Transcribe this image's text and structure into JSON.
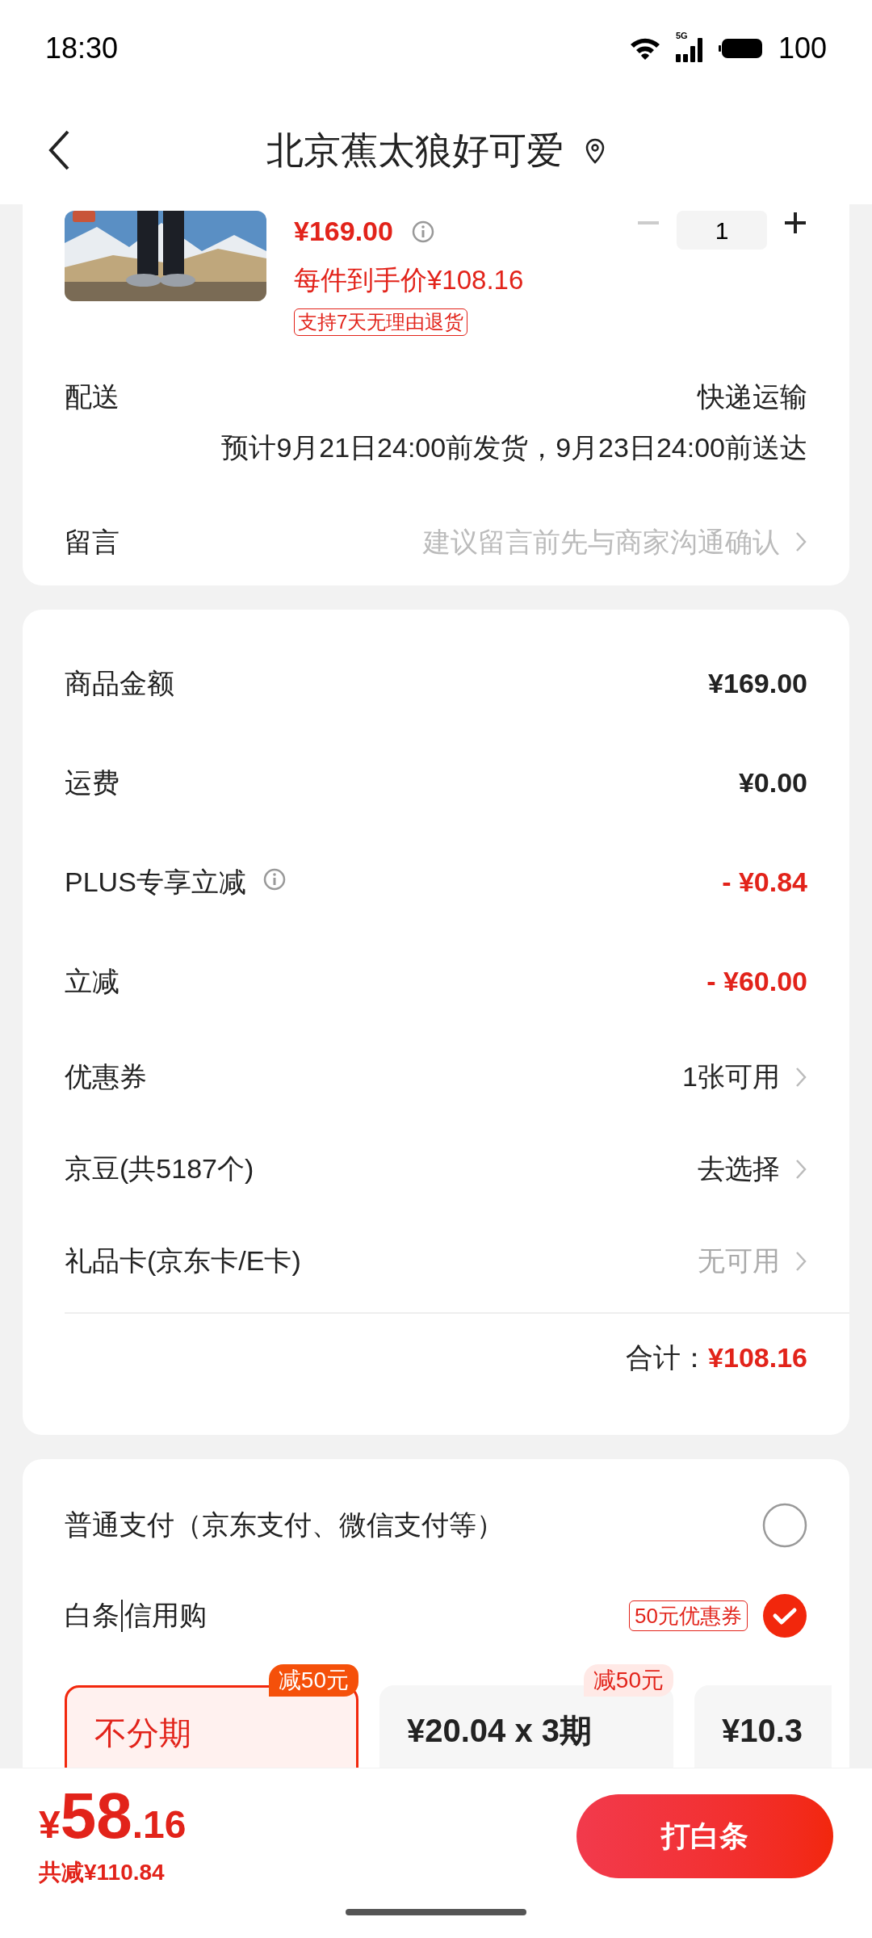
{
  "status_bar": {
    "time": "18:30",
    "network": "5G",
    "battery": "100"
  },
  "header": {
    "title": "北京蕉太狼好可爱"
  },
  "product": {
    "price": "¥169.00",
    "per_item_price": "每件到手价¥108.16",
    "tag": "支持7天无理由退货",
    "quantity": "1"
  },
  "delivery": {
    "label": "配送",
    "method": "快递运输",
    "estimate": "预计9月21日24:00前发货，9月23日24:00前送达"
  },
  "note": {
    "label": "留言",
    "placeholder": "建议留言前先与商家沟通确认"
  },
  "summary": {
    "rows": [
      {
        "kind": "amount",
        "label": "商品金额",
        "value": "¥169.00",
        "info": false
      },
      {
        "kind": "amount",
        "label": "运费",
        "value": "¥0.00",
        "info": false
      },
      {
        "kind": "discount",
        "label": "PLUS专享立减",
        "value": "- ¥0.84",
        "info": true
      },
      {
        "kind": "discount",
        "label": "立减",
        "value": "- ¥60.00",
        "info": false
      },
      {
        "kind": "option",
        "label": "优惠券",
        "value": "1张可用",
        "info": false,
        "disabled": false
      },
      {
        "kind": "option",
        "label": "京豆(共5187个)",
        "value": "去选择",
        "info": false,
        "disabled": false
      },
      {
        "kind": "option",
        "label": "礼品卡(京东卡/E卡)",
        "value": "无可用",
        "info": false,
        "disabled": true
      }
    ],
    "total_label": "合计：",
    "total": "¥108.16"
  },
  "payment": {
    "methods": [
      {
        "label_parts": [
          "普通支付（京东支付、微信支付等）"
        ],
        "selected": false
      },
      {
        "label_parts": [
          "白条",
          "信用购"
        ],
        "badge": "50元优惠券",
        "selected": true
      }
    ],
    "plans": [
      {
        "title": "不分期",
        "tag": "减50元",
        "selected": true
      },
      {
        "title": "¥20.04 x 3期",
        "tag": "减50元",
        "selected": false
      },
      {
        "title": "¥10.3",
        "selected": false
      }
    ]
  },
  "bottom_bar": {
    "currency": "¥",
    "amount": "58",
    "decimals": ".16",
    "saved": "共减¥110.84",
    "button": "打白条"
  }
}
